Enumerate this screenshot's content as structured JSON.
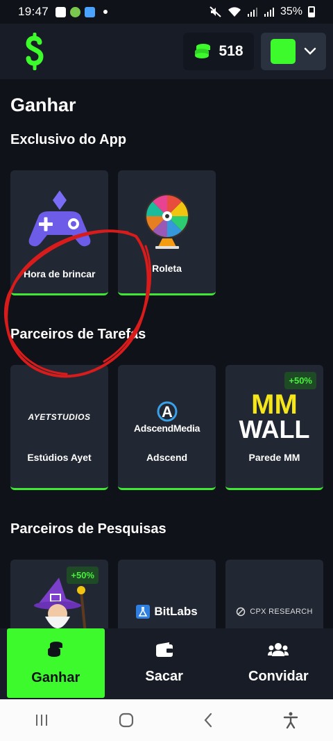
{
  "status_bar": {
    "time": "19:47",
    "battery": "35%"
  },
  "header": {
    "coin_count": "518",
    "logo_icon": "dollar-s-logo",
    "accent_color": "#3cfa2c"
  },
  "page": {
    "title": "Ganhar"
  },
  "sections": {
    "app_exclusive": {
      "title": "Exclusivo do App",
      "cards": [
        {
          "label": "Hora de brincar",
          "icon": "gamepad-icon"
        },
        {
          "label": "Roleta",
          "icon": "roulette-wheel-icon"
        }
      ]
    },
    "task_partners": {
      "title": "Parceiros de Tarefas",
      "cards": [
        {
          "label": "Estúdios Ayet",
          "logo_text": "AYETSTUDIOS"
        },
        {
          "label": "Adscend",
          "logo_text": "AdscendMedia",
          "logo_letter": "A"
        },
        {
          "label": "Parede MM",
          "logo_line1": "MM",
          "logo_line2": "WALL",
          "badge": "+50%"
        }
      ]
    },
    "survey_partners": {
      "title": "Parceiros de Pesquisas",
      "cards": [
        {
          "badge": "+50%",
          "icon": "wizard-icon"
        },
        {
          "logo_text": "BitLabs",
          "logo_prefix": "Bit",
          "logo_suffix": "abs"
        },
        {
          "logo_text": "CPX RESEARCH"
        }
      ]
    }
  },
  "bottom_nav": {
    "items": [
      {
        "label": "Ganhar",
        "icon": "coins-stack-icon",
        "active": true
      },
      {
        "label": "Sacar",
        "icon": "wallet-icon"
      },
      {
        "label": "Convidar",
        "icon": "users-icon"
      }
    ]
  }
}
